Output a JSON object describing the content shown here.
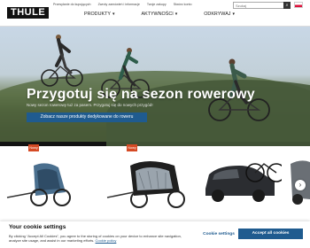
{
  "header": {
    "logo": "THULE",
    "top_links": [
      "Przesyłanie do kupujących",
      "Zwroty zamówień i informacje",
      "Twoje zakupy",
      "Stwórz konto"
    ],
    "nav": [
      {
        "label": "PRODUKTY"
      },
      {
        "label": "AKTYWNOŚCI"
      },
      {
        "label": "ODKRYWAJ"
      }
    ],
    "search_placeholder": "Szukaj"
  },
  "hero": {
    "title": "Przygotuj się na sezon rowerowy",
    "subtitle": "Nowy sezon rowerowy tuż za pasem. Przygotuj się do nowych przygód!",
    "cta": "Zobacz nasze produkty dedykowane do roweru"
  },
  "products": {
    "badges": [
      "Nowy",
      "Nowy"
    ]
  },
  "cookie": {
    "title": "Your cookie settings",
    "text": "By clicking “Accept All Cookies”, you agree to the storing of cookies on your device to enhance site navigation, analyze site usage, and assist in our marketing efforts.",
    "policy_link": "Cookie policy",
    "settings_button": "Cookie settings",
    "accept_button": "Accept all cookies"
  },
  "colors": {
    "accent": "#1f5b8f",
    "badge": "#d54a24"
  }
}
